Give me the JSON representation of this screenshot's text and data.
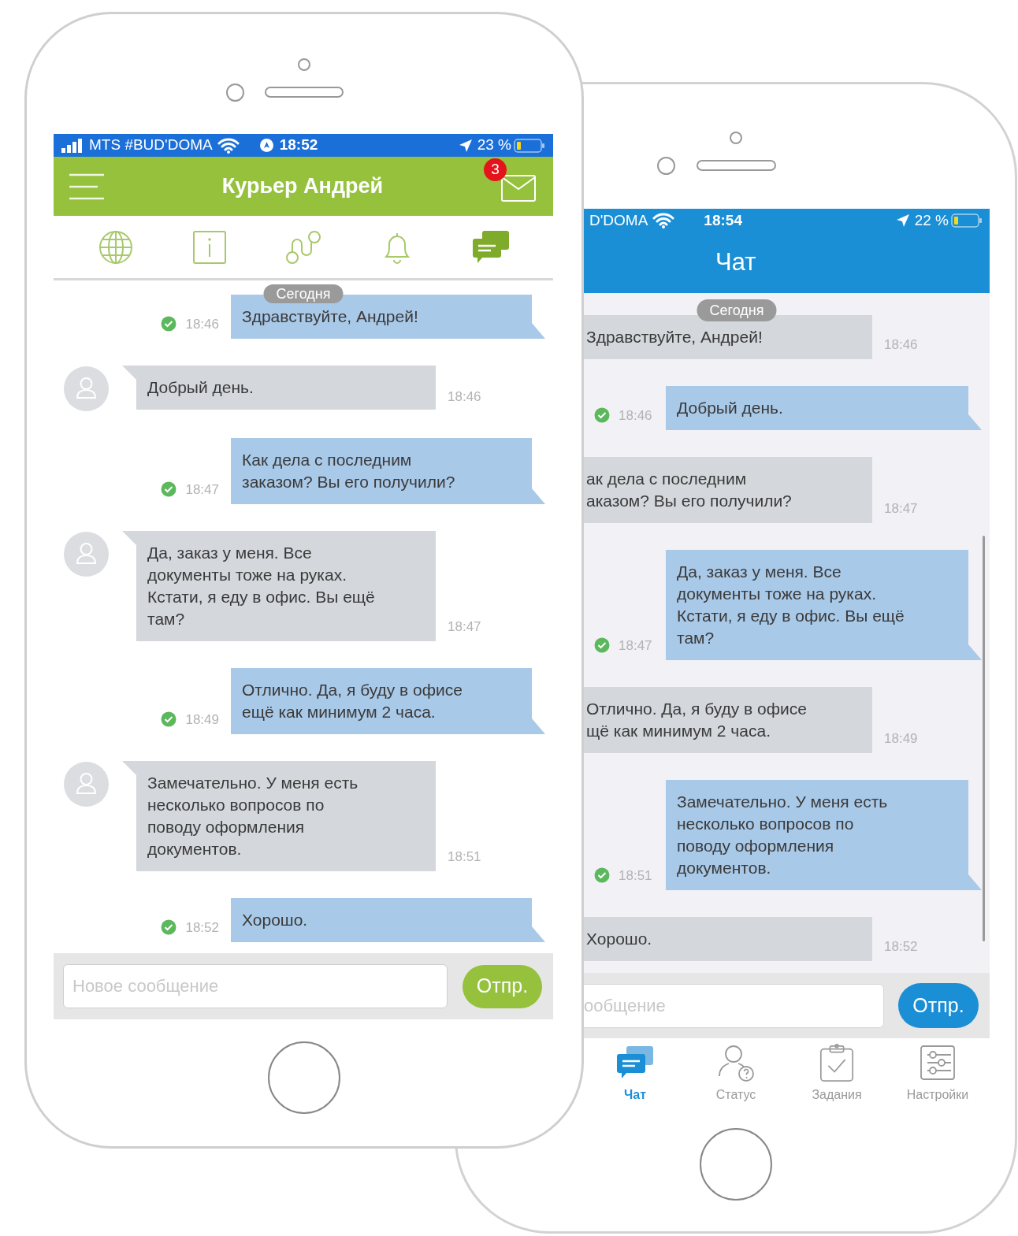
{
  "front_phone": {
    "status_bar": {
      "carrier": "MTS #BUD'DOMA",
      "time": "18:52",
      "battery": "23 %"
    },
    "header": {
      "title": "Курьер Андрей",
      "badge": "3"
    },
    "toolbar": [
      {
        "kind": "globe",
        "selected": false
      },
      {
        "kind": "info",
        "selected": false
      },
      {
        "kind": "route",
        "selected": false
      },
      {
        "kind": "bell",
        "selected": false
      },
      {
        "kind": "chat",
        "selected": true
      }
    ],
    "date_label": "Сегодня",
    "messages": [
      {
        "kind": "outgoing",
        "text": "Здравствуйте, Андрей!",
        "time": "18:46",
        "delivered": true
      },
      {
        "kind": "incoming",
        "text": "Добрый день.",
        "time": "18:46",
        "delivered": false
      },
      {
        "kind": "outgoing",
        "text": "Как дела с последним\nзаказом? Вы его получили?",
        "time": "18:47",
        "delivered": true
      },
      {
        "kind": "incoming",
        "text": "Да, заказ у меня. Все\nдокументы тоже на руках.\nКстати, я еду в офис. Вы ещё\nтам?",
        "time": "18:47",
        "delivered": false
      },
      {
        "kind": "outgoing",
        "text": "Отлично. Да, я буду в офисе\nещё как минимум 2 часа.",
        "time": "18:49",
        "delivered": true
      },
      {
        "kind": "incoming",
        "text": "Замечательно. У меня есть\nнесколько вопросов по\nповоду оформления\nдокументов.",
        "time": "18:51",
        "delivered": false
      },
      {
        "kind": "outgoing",
        "text": "Хорошо.",
        "time": "18:52",
        "delivered": true
      }
    ],
    "composer": {
      "placeholder": "Новое сообщение",
      "send_label": "Отпр."
    }
  },
  "back_phone": {
    "status_bar": {
      "carrier": "D'DOMA",
      "time": "18:54",
      "battery": "22 %"
    },
    "header": {
      "title": "Чат"
    },
    "date_label": "Сегодня",
    "messages": [
      {
        "kind": "incoming",
        "text": "Здравствуйте, Андрей!",
        "time": "18:46",
        "delivered": false
      },
      {
        "kind": "outgoing",
        "text": "Добрый день.",
        "time": "18:46",
        "delivered": true
      },
      {
        "kind": "incoming",
        "text": "ак дела с последним\nаказом? Вы его получили?",
        "time": "18:47",
        "delivered": false
      },
      {
        "kind": "outgoing",
        "text": "Да, заказ у меня. Все\nдокументы тоже на руках.\nКстати, я еду в офис. Вы ещё\nтам?",
        "time": "18:47",
        "delivered": true
      },
      {
        "kind": "incoming",
        "text": "Отлично. Да, я буду в офисе\nщё как минимум 2 часа.",
        "time": "18:49",
        "delivered": false
      },
      {
        "kind": "outgoing",
        "text": "Замечательно. У меня есть\nнесколько вопросов по\nповоду оформления\nдокументов.",
        "time": "18:51",
        "delivered": true
      },
      {
        "kind": "incoming",
        "text": "Хорошо.",
        "time": "18:52",
        "delivered": false
      }
    ],
    "composer": {
      "placeholder": "ообщение",
      "send_label": "Отпр."
    },
    "tabs": [
      {
        "kind": "chat",
        "label": "Чат",
        "selected": true
      },
      {
        "kind": "status",
        "label": "Статус",
        "selected": false
      },
      {
        "kind": "tasks",
        "label": "Задания",
        "selected": false
      },
      {
        "kind": "settings",
        "label": "Настройки",
        "selected": false
      }
    ]
  }
}
